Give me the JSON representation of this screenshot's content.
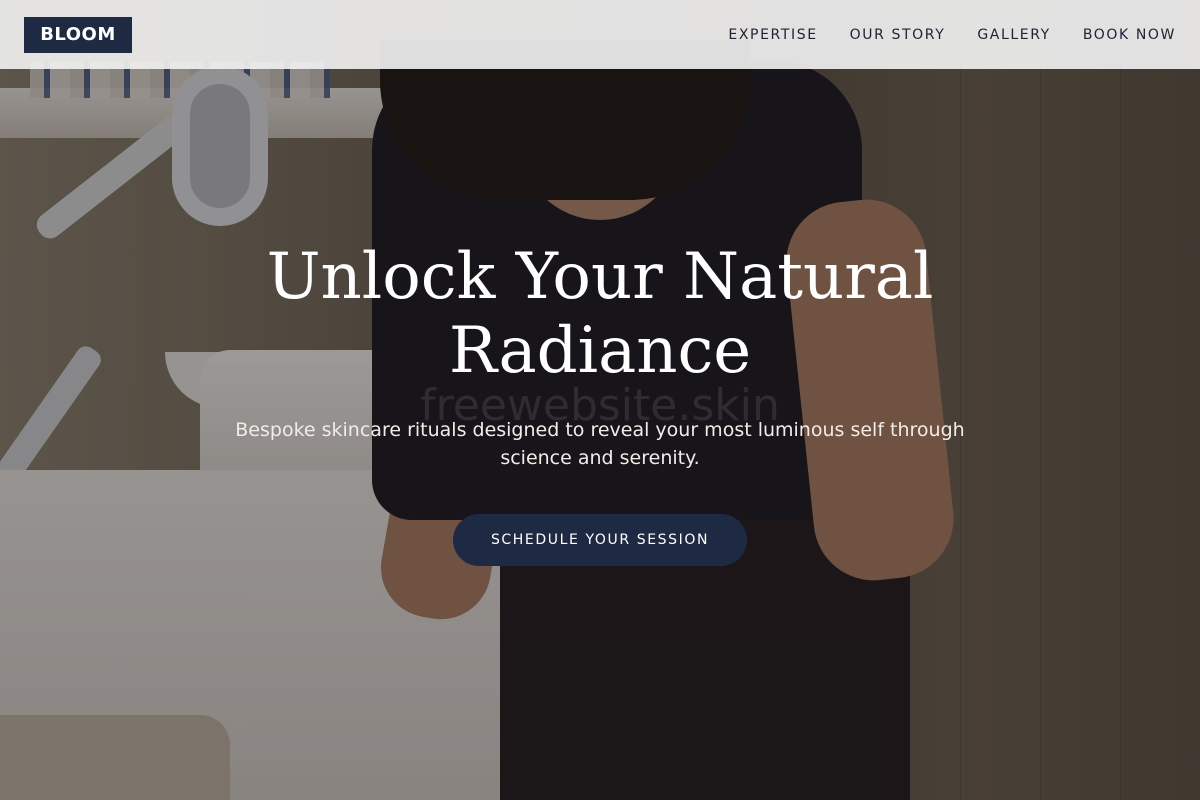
{
  "header": {
    "logo": "BLOOM",
    "nav": [
      {
        "label": "EXPERTISE"
      },
      {
        "label": "OUR STORY"
      },
      {
        "label": "GALLERY"
      },
      {
        "label": "BOOK NOW"
      }
    ]
  },
  "hero": {
    "title": "Unlock Your Natural Radiance",
    "subtitle": "Bespoke skincare rituals designed to reveal your most luminous self through science and serenity.",
    "cta_label": "SCHEDULE YOUR SESSION",
    "watermark": "freewebsite.skin"
  },
  "colors": {
    "brand_navy": "#1e2a44",
    "header_bg": "#f0f0f0",
    "text_light": "#ffffff"
  }
}
